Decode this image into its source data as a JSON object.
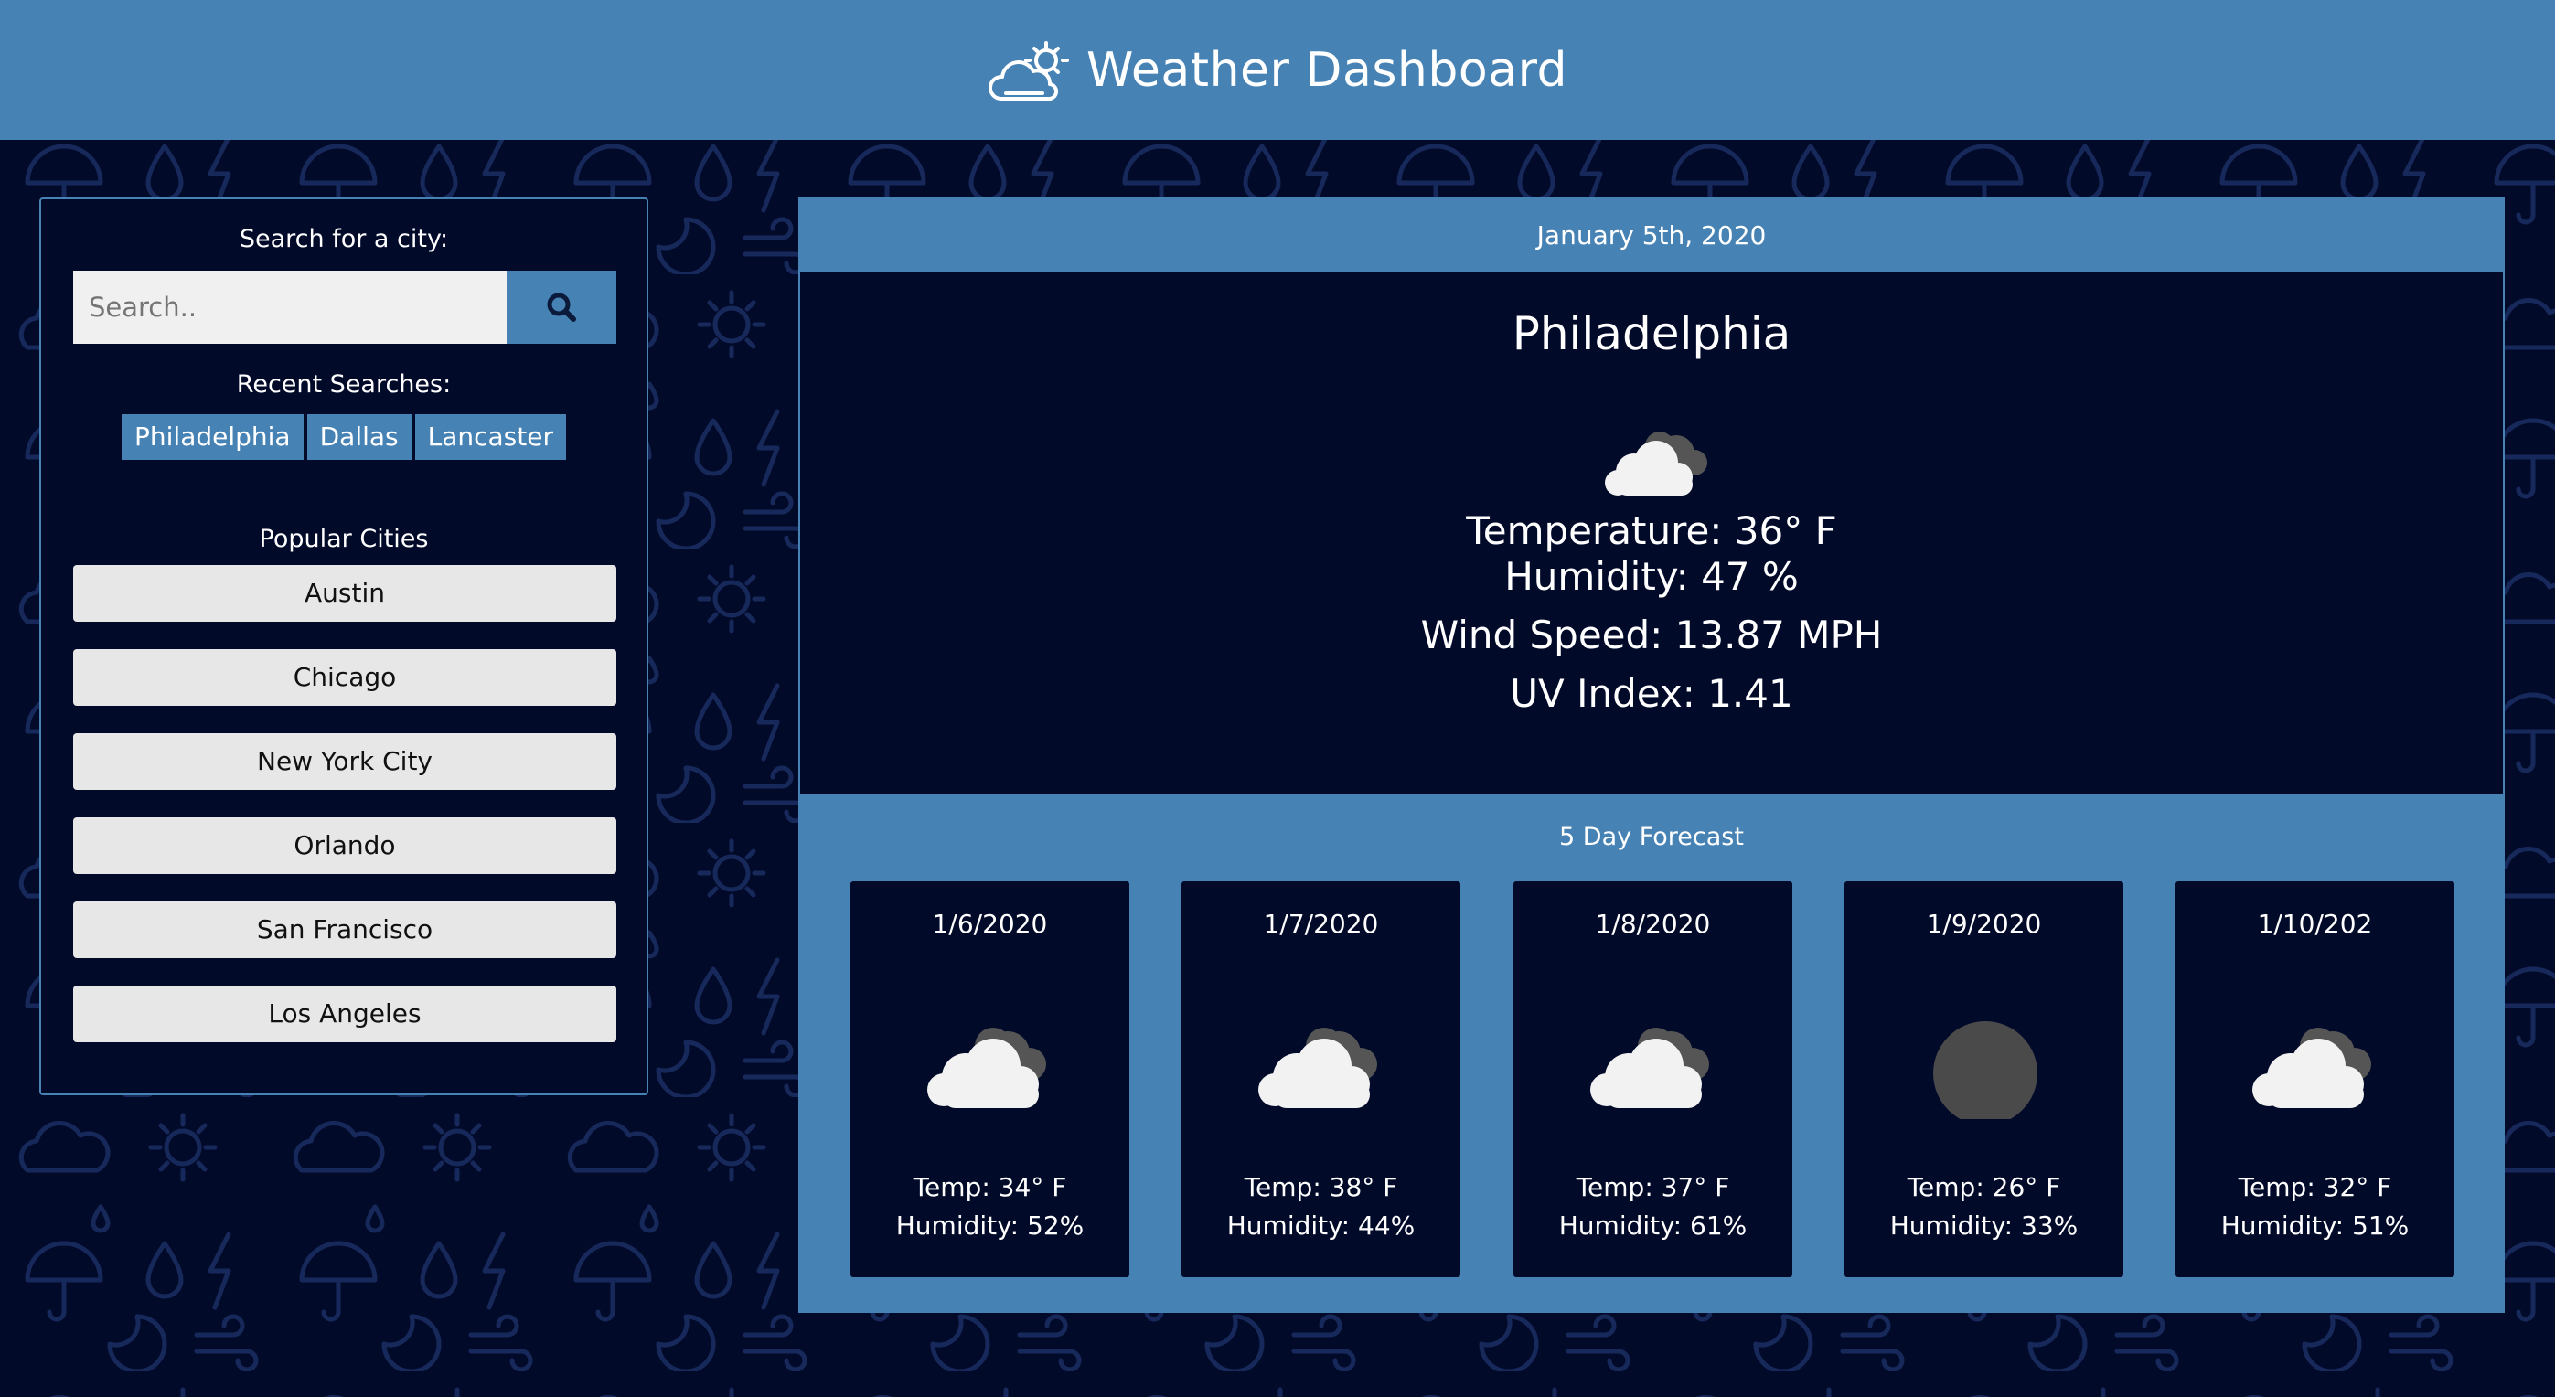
{
  "header": {
    "title": "Weather Dashboard",
    "icon": "partly-cloudy-icon"
  },
  "search": {
    "label": "Search for a city:",
    "placeholder": "Search..",
    "value": "",
    "button_icon": "search-icon",
    "recent_label": "Recent Searches:",
    "recent": [
      "Philadelphia",
      "Dallas",
      "Lancaster"
    ],
    "popular_label": "Popular Cities",
    "popular": [
      "Austin",
      "Chicago",
      "New York City",
      "Orlando",
      "San Francisco",
      "Los Angeles"
    ]
  },
  "current": {
    "date": "January 5th, 2020",
    "city": "Philadelphia",
    "icon": "partly-cloudy-icon",
    "temperature": "Temperature: 36° F",
    "humidity": "Humidity: 47 %",
    "wind": "Wind Speed: 13.87 MPH",
    "uv": "UV Index: 1.41"
  },
  "forecast": {
    "title": "5 Day Forecast",
    "days": [
      {
        "date": "1/6/2020",
        "icon": "clouds-icon",
        "temp": "Temp: 34° F",
        "humidity": "Humidity: 52%"
      },
      {
        "date": "1/7/2020",
        "icon": "clouds-icon",
        "temp": "Temp: 38° F",
        "humidity": "Humidity: 44%"
      },
      {
        "date": "1/8/2020",
        "icon": "clouds-icon",
        "temp": "Temp: 37° F",
        "humidity": "Humidity: 61%"
      },
      {
        "date": "1/9/2020",
        "icon": "overcast-moon-icon",
        "temp": "Temp: 26° F",
        "humidity": "Humidity: 33%"
      },
      {
        "date": "1/10/202",
        "icon": "clouds-icon",
        "temp": "Temp: 32° F",
        "humidity": "Humidity: 51%"
      }
    ]
  },
  "colors": {
    "accent": "#4682b4",
    "background": "#020a2a",
    "button": "#e7e7e7"
  }
}
